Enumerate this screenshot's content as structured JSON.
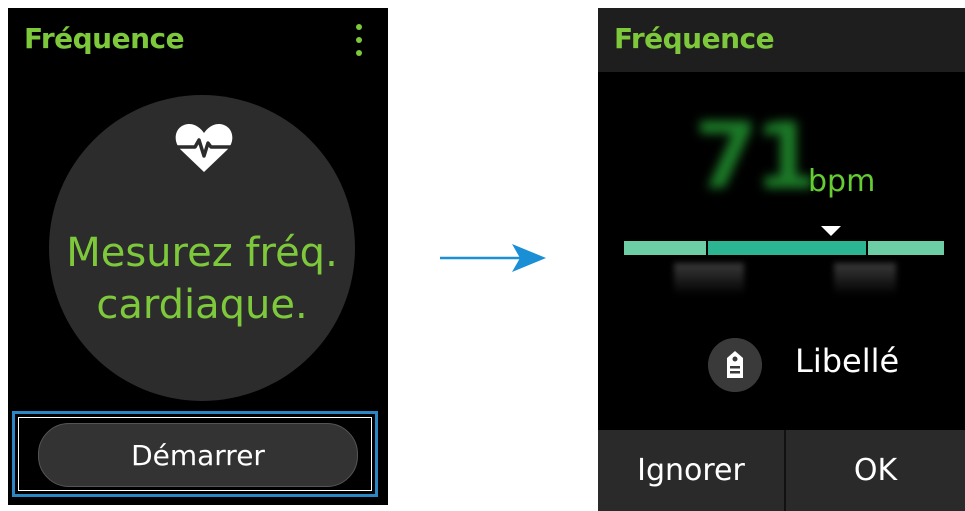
{
  "screen1": {
    "title": "Fréquence",
    "prompt_line1": "Mesurez fréq.",
    "prompt_line2": "cardiaque.",
    "start_label": "Démarrer",
    "icons": {
      "heart": "heart-rate-icon",
      "menu": "more-options-icon"
    }
  },
  "screen2": {
    "title": "Fréquence",
    "bpm_value": "71",
    "bpm_unit": "bpm",
    "tag_label": "Libellé",
    "ignore_label": "Ignorer",
    "ok_label": "OK",
    "icons": {
      "tag": "tag-icon"
    }
  },
  "transition": {
    "icon": "right-arrow-icon",
    "color": "#1a8fd6"
  },
  "colors": {
    "accent_green": "#7dc93b",
    "highlight_frame": "#2a86c4",
    "scale_mid": "#2bb593",
    "scale_edge": "#6dcea6"
  }
}
